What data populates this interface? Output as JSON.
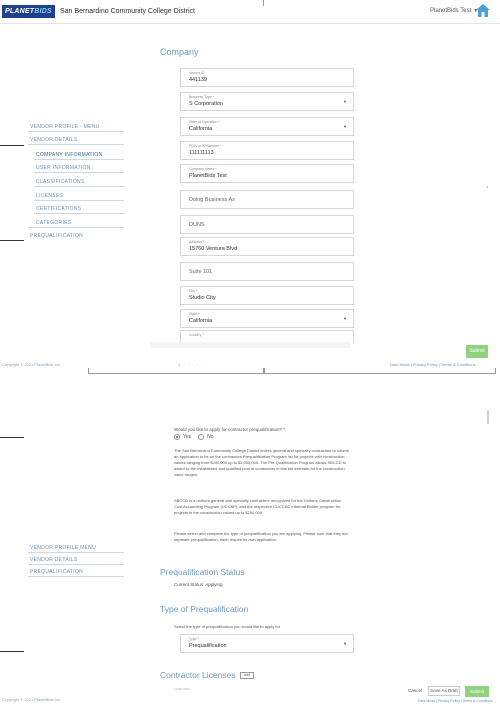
{
  "header": {
    "logo_main": "PLANET",
    "logo_accent": "BIDS",
    "district": "San Bernardino Community College District",
    "user": "PlanetBids Test"
  },
  "sidebar_top": {
    "vendor_profile": "VENDOR PROFILE - MENU",
    "vendor_details": "VENDOR DETAILS",
    "company_information": "COMPANY INFORMATION",
    "user_information": "USER INFORMATION",
    "classifications": "CLASSIFICATIONS",
    "licenses": "LICENSES",
    "certifications": "CERTIFICATIONS",
    "categories": "CATEGORIES",
    "prequalification": "PREQUALIFICATION"
  },
  "company": {
    "title": "Company",
    "fields": [
      {
        "label": "Vendor ID",
        "value": "441139"
      },
      {
        "label": "Business Type *",
        "value": "S Corporation"
      },
      {
        "label": "State of Operation *",
        "value": "California"
      },
      {
        "label": "FEIN or ID Number *",
        "value": "111111113"
      },
      {
        "label": "Company Name *",
        "value": "PlanetBids Test"
      },
      {
        "label": "",
        "value": "Doing Business As"
      },
      {
        "label": "",
        "value": "DUNS"
      },
      {
        "label": "Address *",
        "value": "15760 Ventura Blvd"
      },
      {
        "label": "",
        "value": "Suite 101"
      },
      {
        "label": "City *",
        "value": "Studio City"
      },
      {
        "label": "State *",
        "value": "California"
      },
      {
        "label": "Country *",
        "value": ""
      }
    ]
  },
  "footer1": {
    "submit": "Submit",
    "copyright": "Copyright © 2021 PlanetBids Inc",
    "dots": "1 · · · · ·",
    "links": "Dark Mode | Privacy Policy | Terms & Conditions"
  },
  "sidebar_bottom": {
    "vendor_profile": "VENDOR PROFILE MENU",
    "vendor_details": "VENDOR DETAILS",
    "prequalification": "PREQUALIFICATION"
  },
  "prequal": {
    "question": "Would you like to apply for contractor prequalification? *",
    "yes": "Yes",
    "no": "No",
    "para1": "The San Bernardino Community College District invites general and specialty contractors to submit an application to be on the contractors Prequalification Program list for projects with construction values ranging from $200,000 up to $3,000,000. The Pre-Qualification Program allows SBCCD to award to the established and qualified pool of contractors in this bid estimate for the construction value ranges.",
    "para2": "SBCCD is a uniform general and specialty contractors recognized for the Uniform Construction Cost Accounting Program (UCCAP), and the respective CUCCAC Informal Bidder program for projects in the construction values up to $200,000.",
    "para3": "Please select and complete the type of prequalification you are applying. Please note that they are separate prequalification, each require its own application.",
    "status_title": "Prequalification Status",
    "status_value": "Current Status: Applying",
    "type_title": "Type of Prequalification",
    "type_text": "Select the type of prequalification you would like to apply for",
    "type_label": "Type *",
    "type_value": "Prequalification",
    "licenses_title": "Contractor Licenses",
    "licenses_badge": "Add",
    "licenses_hint": "Licenses"
  },
  "footer2": {
    "copyright": "Copyright © 2021 PlanetBids Inc",
    "cancel": "Cancel",
    "save": "Save As Draft",
    "submit": "Submit",
    "links": "Dark Mode | Privacy Policy | Terms & Conditions"
  }
}
